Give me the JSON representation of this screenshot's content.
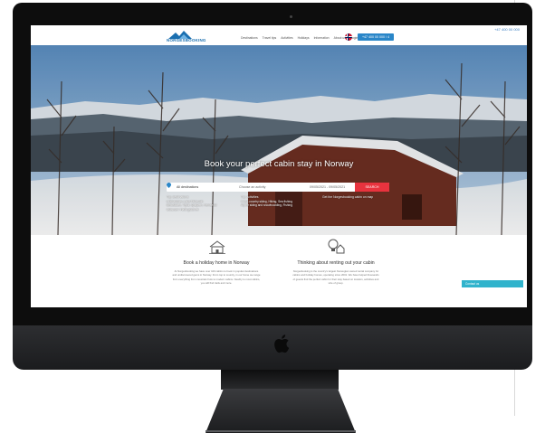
{
  "header": {
    "phone": "+47 400 00 000",
    "logo_text": "NORGESBOOKING",
    "nav": [
      "Destinations",
      "Travel tips",
      "Activities",
      "Holidays",
      "Information",
      "About us",
      "Login"
    ],
    "contact_label": "+47 400 00 000 / 4"
  },
  "hero": {
    "title": "Book your perfect cabin stay in Norway",
    "search": {
      "destination": "All destinations",
      "activity": "Choose an activity",
      "dates": "09/05/2021 - 09/05/2021",
      "button": "SEARCH"
    },
    "suggestions": [
      {
        "heading": "Top destinations",
        "lines": [
          "Lillehammer, Lake Fiskevatn",
          "Beitostølen, Trysil, Sjusjøen, Hemsedal",
          "Ustaoset / Hallingskarvet"
        ]
      },
      {
        "heading": "Top activities",
        "lines": [
          "Cross country skiing, Hiking, Sea fishing",
          "Alpine skiing and snowboarding, Fishing"
        ]
      },
      {
        "heading": "Get the Norgesbooking cabin on map",
        "lines": []
      }
    ]
  },
  "sections": [
    {
      "title": "Book a holiday home in Norway",
      "text": "At Norgesbooking we have over 100 cabins to book in popular destinations and undiscovered gems in Norway. From top to country, in our home we range from everything from mountain huts to modern cabins. Nearby to most cabins, you will find trails and more."
    },
    {
      "title": "Thinking about renting out your cabin",
      "text": "Norgesbooking is the country's largest Norwegian owned rental company for cabins and holiday homes, operating since 2001. We have helped thousands of guests find the perfect cabin for their stay based on location, activities and size of group."
    }
  ],
  "chat": {
    "label": "Contact us"
  },
  "colors": {
    "accent": "#e8333e",
    "brand": "#2a86c8",
    "chat": "#30b3cc"
  }
}
